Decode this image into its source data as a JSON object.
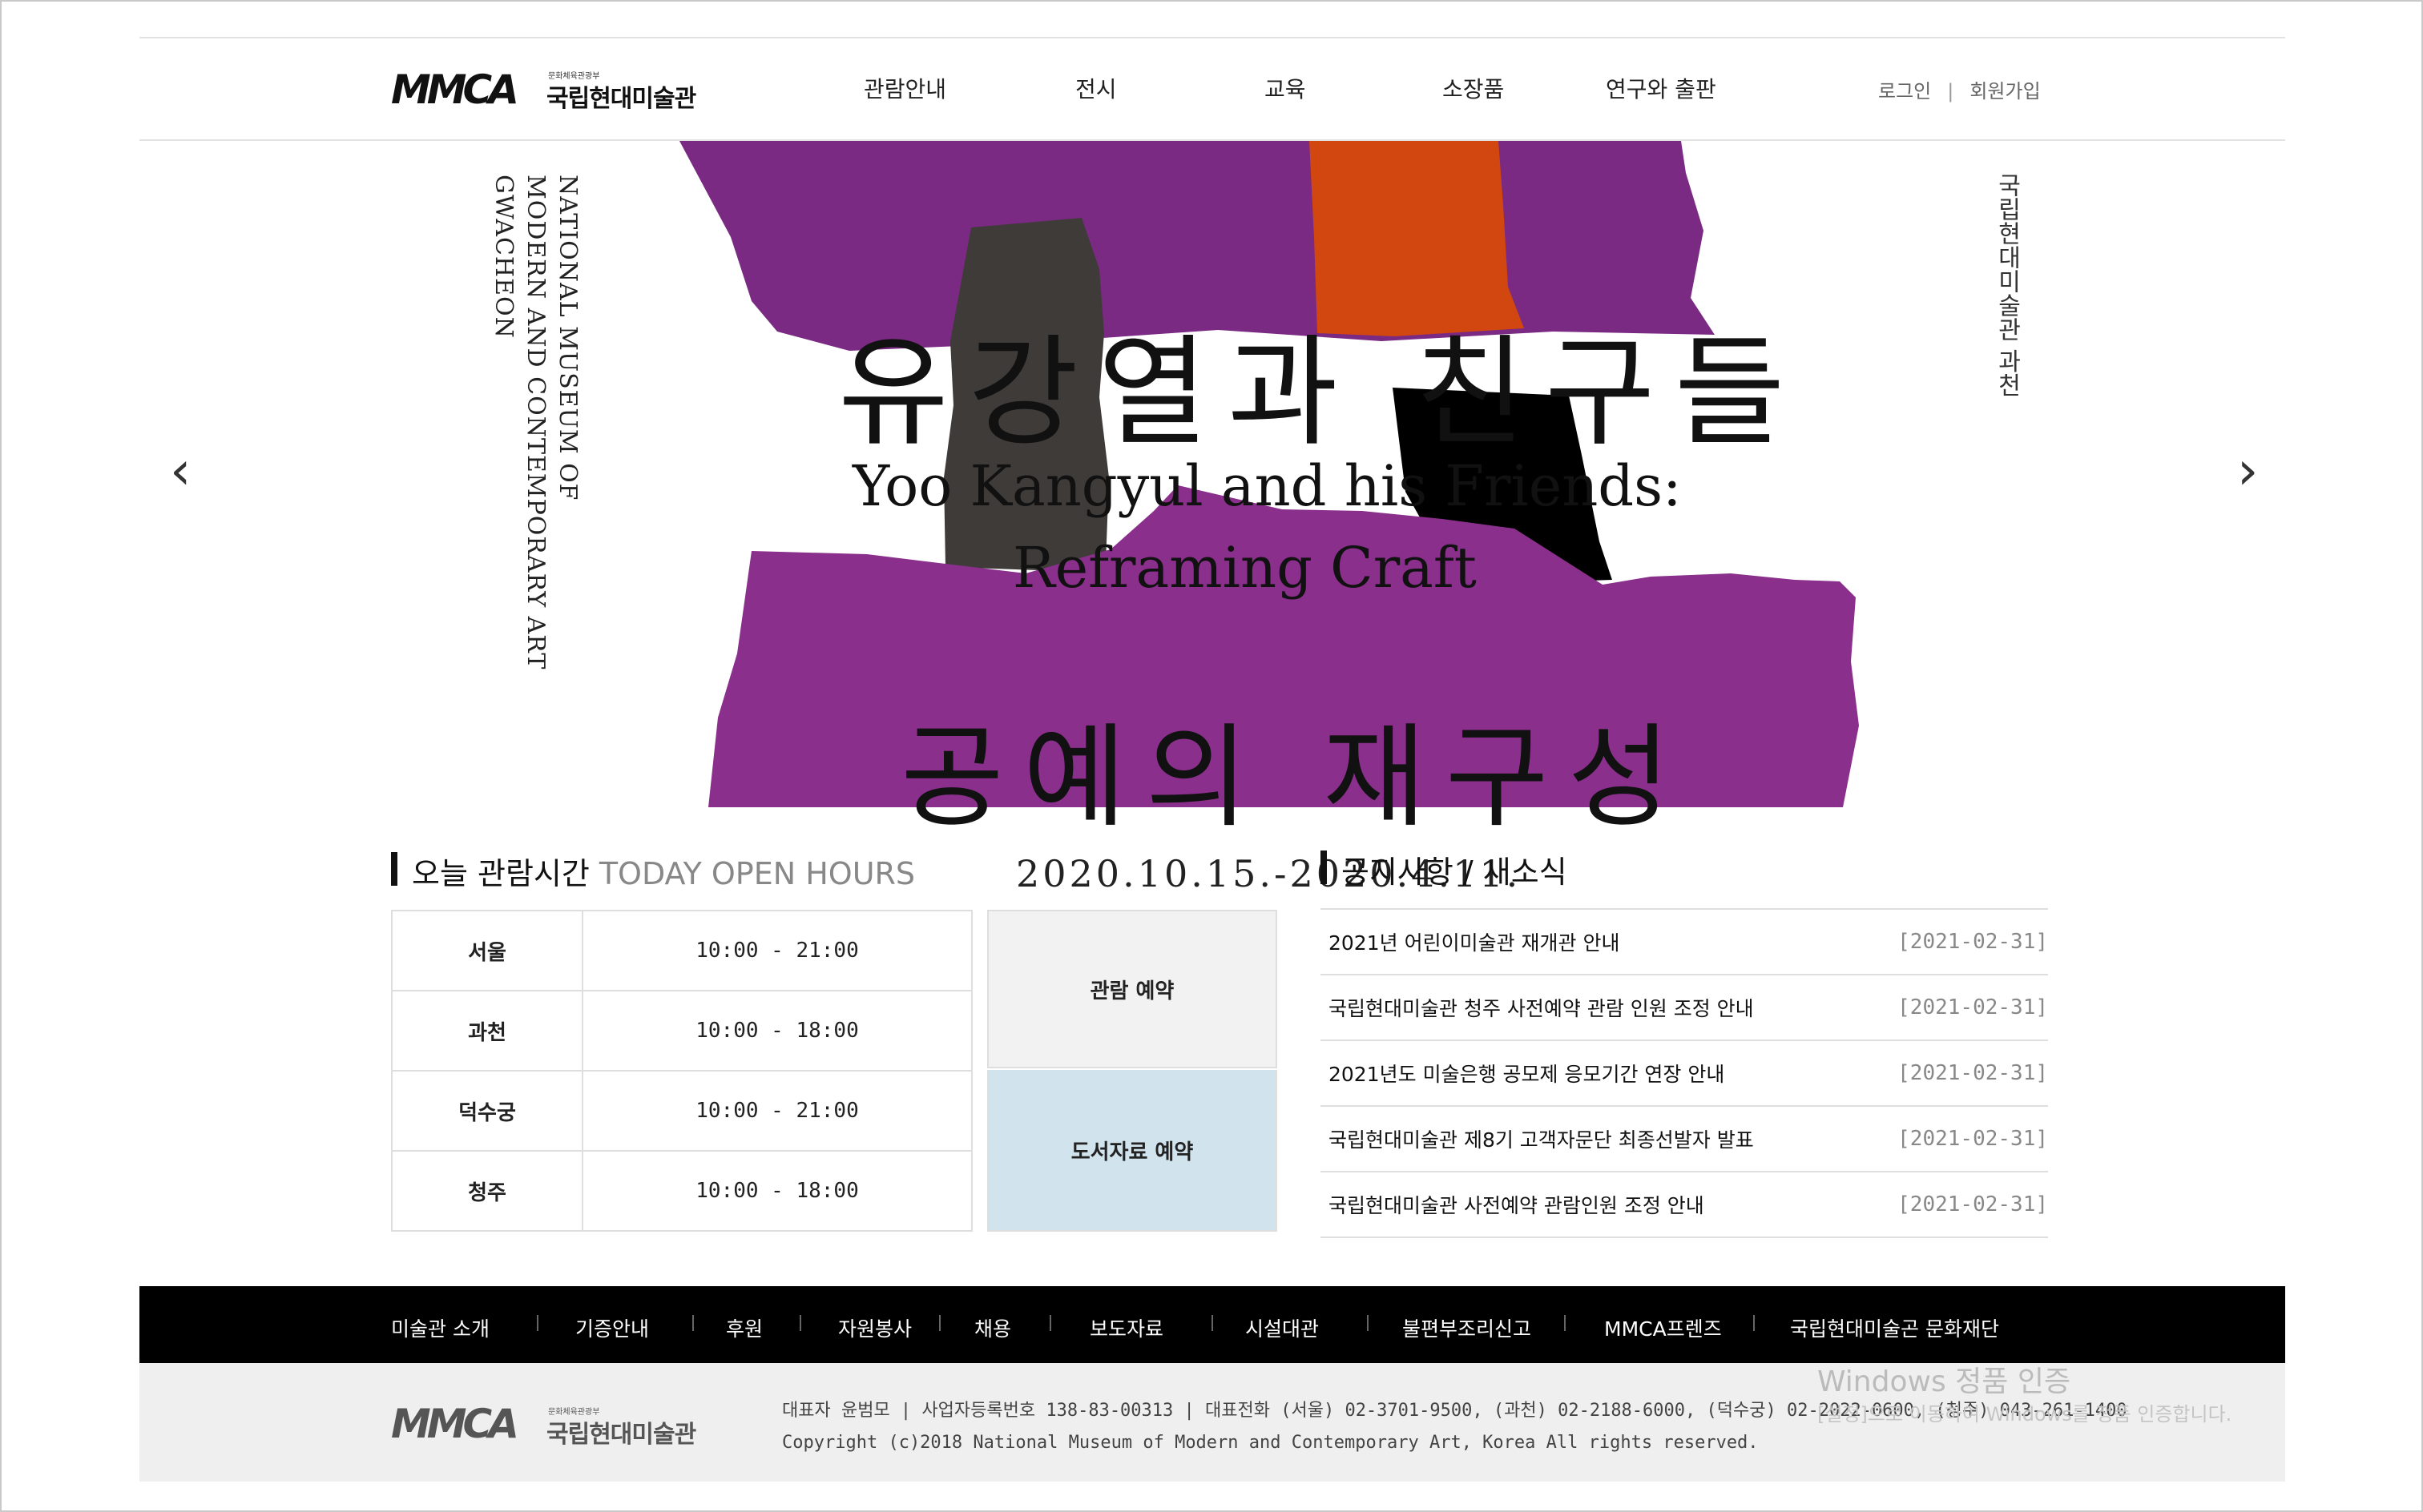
{
  "header": {
    "logo_mark": "MMCA",
    "logo_small": "문화체육관광부",
    "logo_name": "국립현대미술관",
    "nav": [
      "관람안내",
      "전시",
      "교육",
      "소장품",
      "연구와 출판"
    ],
    "login": "로그인",
    "separator": "|",
    "signup": "회원가입"
  },
  "hero": {
    "title_ko_1": "유강열과 친구들",
    "title_en_1": "Yoo Kangyul and his Friends:",
    "title_en_2": "Reframing Craft",
    "title_ko_2": "공예의 재구성",
    "date": "2020.10.15.-2020.4.11.",
    "side_en": "NATIONAL MUSEUM OF\nMODERN AND CONTEMPORARY ART\nGWACHEON",
    "side_ko": "국립현대미술관 과천",
    "prev_arrow": "‹",
    "next_arrow": "›",
    "colors": {
      "purple": "#7b2a83",
      "purple_light": "#8a2f8c",
      "orange": "#d2470f",
      "gray": "#3f3b39",
      "black": "#000000"
    },
    "slides": 3
  },
  "hours": {
    "title": "오늘 관람시간",
    "title_en": "TODAY OPEN HOURS",
    "rows": [
      {
        "city": "서울",
        "time": "10:00 - 21:00"
      },
      {
        "city": "과천",
        "time": "10:00 - 18:00"
      },
      {
        "city": "덕수궁",
        "time": "10:00 - 21:00"
      },
      {
        "city": "청주",
        "time": "10:00 - 18:00"
      }
    ],
    "reserve_label": "관람 예약",
    "library_label": "도서자료 예약"
  },
  "notices": {
    "title": "공지사항 / 새소식",
    "items": [
      {
        "title": "2021년 어린이미술관 재개관 안내",
        "date": "[2021-02-31]"
      },
      {
        "title": "국립현대미술관 청주 사전예약 관람 인원 조정 안내",
        "date": "[2021-02-31]"
      },
      {
        "title": "2021년도 미술은행 공모제 응모기간 연장 안내",
        "date": "[2021-02-31]"
      },
      {
        "title": "국립현대미술관 제8기 고객자문단 최종선발자 발표",
        "date": "[2021-02-31]"
      },
      {
        "title": "국립현대미술관 사전예약 관람인원 조정 안내",
        "date": "[2021-02-31]"
      }
    ]
  },
  "footer": {
    "links": [
      "미술관 소개",
      "기증안내",
      "후원",
      "자원봉사",
      "채용",
      "보도자료",
      "시설대관",
      "불편부조리신고",
      "MMCA프렌즈",
      "국립현대미술곤 문화재단"
    ],
    "info_line1": "대표자 윤범모 | 사업자등록번호 138-83-00313 | 대표전화 (서울) 02-3701-9500, (과천) 02-2188-6000, (덕수궁) 02-2022-0600, (청주) 043-261-1400",
    "info_line2": "Copyright (c)2018 National Museum of Modern and Contemporary Art, Korea All rights reserved."
  },
  "watermark": {
    "line1": "Windows 정품 인증",
    "line2": "[설정]으로 이동하여 Windows를 정품 인증합니다."
  }
}
